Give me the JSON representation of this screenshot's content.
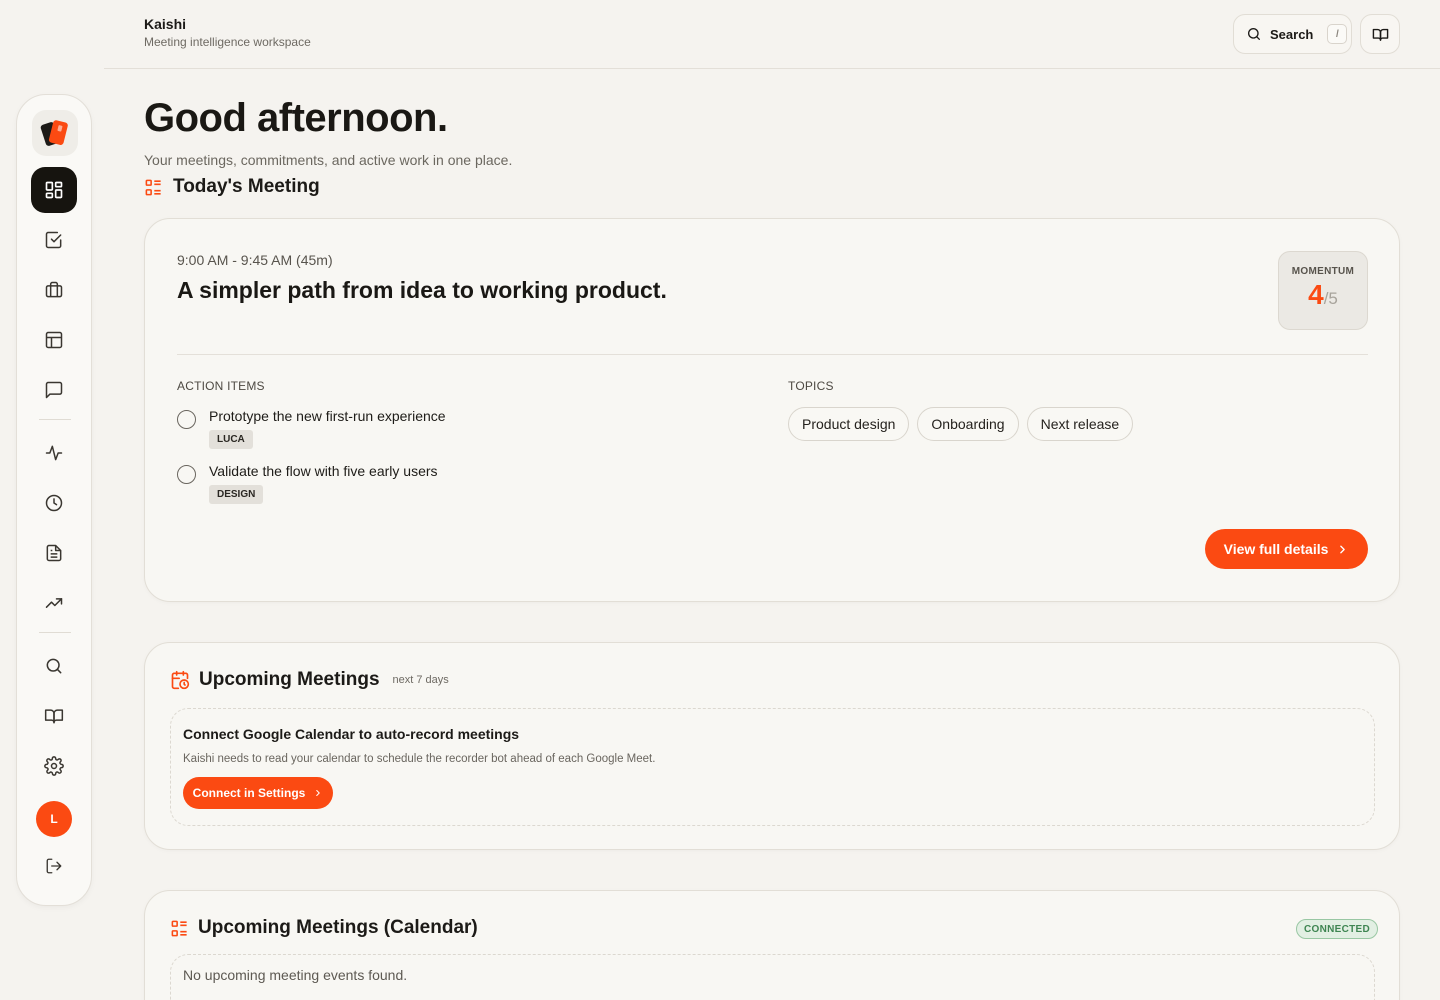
{
  "header": {
    "brand": "Kaishi",
    "tagline": "Meeting intelligence workspace",
    "search_label": "Search",
    "search_shortcut": "/"
  },
  "sidebar": {
    "avatar_initial": "L",
    "items": [
      {
        "icon": "dashboard-icon",
        "active": true
      },
      {
        "icon": "checkbox-icon"
      },
      {
        "icon": "briefcase-icon"
      },
      {
        "icon": "layout-icon"
      },
      {
        "icon": "message-icon"
      },
      {
        "icon": "activity-icon"
      },
      {
        "icon": "clock-icon"
      },
      {
        "icon": "document-icon"
      },
      {
        "icon": "trending-icon"
      },
      {
        "icon": "search-icon"
      },
      {
        "icon": "book-icon"
      },
      {
        "icon": "gear-icon"
      },
      {
        "icon": "logout-icon"
      }
    ]
  },
  "greeting": "Good afternoon.",
  "subtitle": "Your meetings, commitments, and active work in one place.",
  "today": {
    "section_title": "Today's Meeting",
    "time": "9:00 AM - 9:45 AM (45m)",
    "title": "A simpler path from idea to working product.",
    "momentum_label": "MOMENTUM",
    "momentum_value": "4",
    "momentum_max": "/5",
    "action_items_label": "ACTION ITEMS",
    "action_items": [
      {
        "text": "Prototype the new first-run experience",
        "tag": "LUCA"
      },
      {
        "text": "Validate the flow with five early users",
        "tag": "DESIGN"
      }
    ],
    "topics_label": "TOPICS",
    "topics": [
      "Product design",
      "Onboarding",
      "Next release"
    ],
    "view_button": "View full details"
  },
  "upcoming": {
    "title": "Upcoming Meetings",
    "hint": "next 7 days",
    "connect_title": "Connect Google Calendar to auto-record meetings",
    "connect_desc": "Kaishi needs to read your calendar to schedule the recorder bot ahead of each Google Meet.",
    "connect_button": "Connect in Settings"
  },
  "calendar": {
    "title": "Upcoming Meetings (Calendar)",
    "status": "CONNECTED",
    "empty": "No upcoming meeting events found."
  },
  "colors": {
    "accent": "#fb4a12",
    "background": "#f5f3ef",
    "status_ok": "#3f8552"
  }
}
